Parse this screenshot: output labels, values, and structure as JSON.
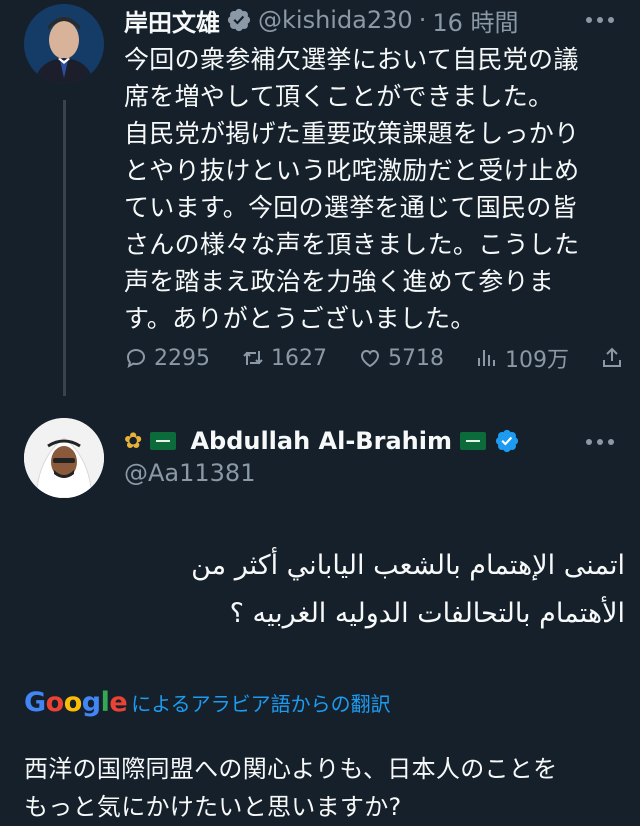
{
  "tweet": {
    "author_name": "岸田文雄",
    "handle": "@kishida230",
    "separator": "·",
    "time": "16 時間",
    "text_lines": [
      "今回の衆参補欠選挙において自民党の議",
      "席を増やして頂くことができました。",
      "自民党が掲げた重要政策課題をしっかり",
      "とやり抜けという叱咤激励だと受け止め",
      "ています。今回の選挙を通じて国民の皆",
      "さんの様々な声を頂きました。こうした",
      "声を踏まえ政治を力強く進めて参りま",
      "す。ありがとうございました。"
    ],
    "actions": {
      "replies": "2295",
      "retweets": "1627",
      "likes": "5718",
      "views": "109万"
    }
  },
  "reply": {
    "author_name": "Abdullah Al-Brahim",
    "handle": "@Aa11381",
    "arabic_lines": [
      "اتمنى الإهتمام بالشعب الياباني أكثر من",
      "الأهتمام بالتحالفات الدوليه الغربيه ؟"
    ],
    "translation_label": "によるアラビア語からの翻訳",
    "google_logo_text": "Google",
    "translation_lines": [
      "西洋の国際同盟への関心よりも、日本人のことを",
      "もっと気にかけたいと思いますか?"
    ]
  },
  "colors": {
    "background": "#15202b",
    "text": "#f7f9f9",
    "muted": "#8b98a5",
    "verified": "#1d9bf0",
    "divider": "#38444d"
  },
  "icons": [
    "verified-icon",
    "more-icon",
    "reply-icon",
    "retweet-icon",
    "like-icon",
    "views-icon",
    "share-icon",
    "flag-icon",
    "bouquet-icon"
  ]
}
